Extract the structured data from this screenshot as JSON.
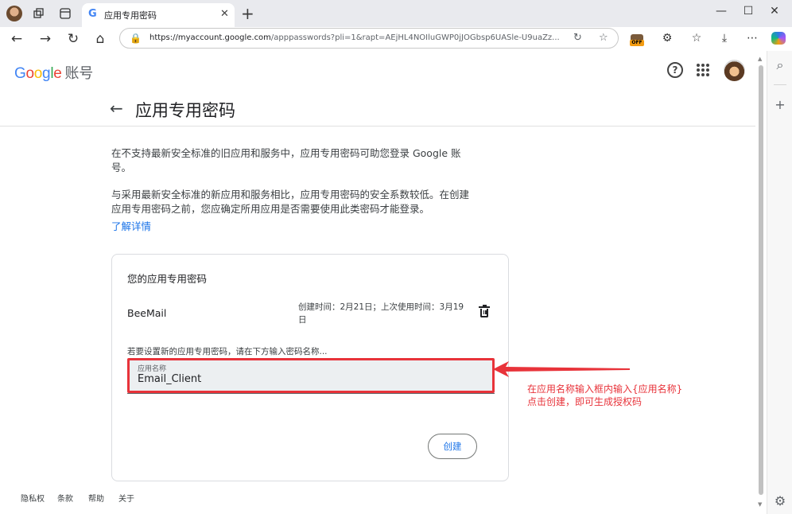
{
  "browser": {
    "tab_title": "应用专用密码",
    "url_domain": "https://myaccount.google.com",
    "url_rest": "/apppasswords?pli=1&rapt=AEjHL4NOIluGWP0jJOGbsp6UASle-U9uaZz...",
    "ext_badge": "OFF"
  },
  "header": {
    "logo_parts": [
      "G",
      "o",
      "o",
      "g",
      "l",
      "e"
    ],
    "account_label": "账号"
  },
  "page": {
    "title": "应用专用密码",
    "intro1": "在不支持最新安全标准的旧应用和服务中，应用专用密码可助您登录 Google 账号。",
    "intro2": "与采用最新安全标准的新应用和服务相比，应用专用密码的安全系数较低。在创建应用专用密码之前，您应确定所用应用是否需要使用此类密码才能登录。",
    "learn_more": "了解详情"
  },
  "card": {
    "heading": "您的应用专用密码",
    "app_name": "BeeMail",
    "app_meta": "创建时间：2月21日；上次使用时间：3月19日",
    "hint": "若要设置新的应用专用密码，请在下方输入密码名称...",
    "field_label": "应用名称",
    "field_value": "Email_Client",
    "create_label": "创建"
  },
  "footer": {
    "links": [
      "隐私权",
      "条款",
      "帮助",
      "关于"
    ]
  },
  "annotation": {
    "line1": "在应用名称输入框内输入{应用名称}",
    "line2": "点击创建，即可生成授权码",
    "color": "#e8333a"
  },
  "colors": {
    "google_blue": "#4285f4",
    "google_red": "#ea4335",
    "google_yellow": "#fbbc05",
    "google_green": "#34a853",
    "link_blue": "#1a73e8"
  },
  "icons": {
    "tab_bar": [
      "profile-avatar",
      "workspaces-icon",
      "vertical-tabs-icon"
    ],
    "nav": [
      "back-icon",
      "forward-icon",
      "refresh-icon",
      "home-icon"
    ],
    "toolbar": [
      "extension-icon",
      "favorites-icon",
      "downloads-icon",
      "more-icon",
      "copilot-icon"
    ],
    "sidebar": [
      "search-icon",
      "add-icon",
      "settings-icon"
    ]
  }
}
